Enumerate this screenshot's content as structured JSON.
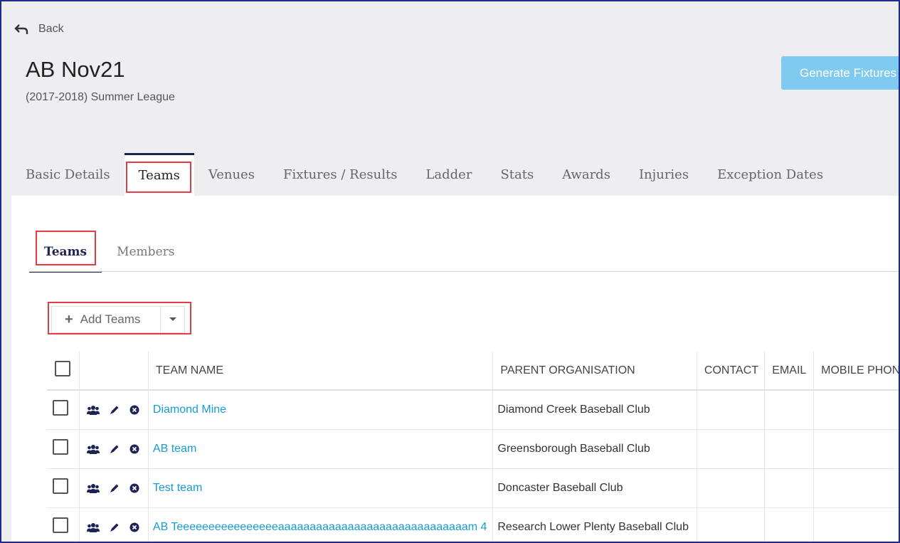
{
  "back": {
    "label": "Back"
  },
  "page": {
    "title": "AB Nov21",
    "subtitle": "(2017-2018) Summer League",
    "generate_label": "Generate Fixtures"
  },
  "tabs": [
    {
      "label": "Basic Details"
    },
    {
      "label": "Teams"
    },
    {
      "label": "Venues"
    },
    {
      "label": "Fixtures / Results"
    },
    {
      "label": "Ladder"
    },
    {
      "label": "Stats"
    },
    {
      "label": "Awards"
    },
    {
      "label": "Injuries"
    },
    {
      "label": "Exception Dates"
    }
  ],
  "subtabs": [
    {
      "label": "Teams"
    },
    {
      "label": "Members"
    }
  ],
  "add_button": {
    "label": "Add Teams"
  },
  "table": {
    "headers": [
      "TEAM NAME",
      "PARENT ORGANISATION",
      "CONTACT",
      "EMAIL",
      "MOBILE PHONE"
    ],
    "rows": [
      {
        "team": "Diamond Mine",
        "org": "Diamond Creek Baseball Club"
      },
      {
        "team": "AB team",
        "org": "Greensborough Baseball Club"
      },
      {
        "team": "Test team",
        "org": "Doncaster Baseball Club"
      },
      {
        "team": "AB Teeeeeeeeeeeeeeeeaaaaaaaaaaaaaaaaaaaaaaaaaaaaaam 4",
        "org": "Research Lower Plenty Baseball Club"
      }
    ]
  },
  "colors": {
    "accent": "#1d2455",
    "link": "#169bd5",
    "highlight": "#e53b43",
    "generate_button": "#7fcbef"
  }
}
